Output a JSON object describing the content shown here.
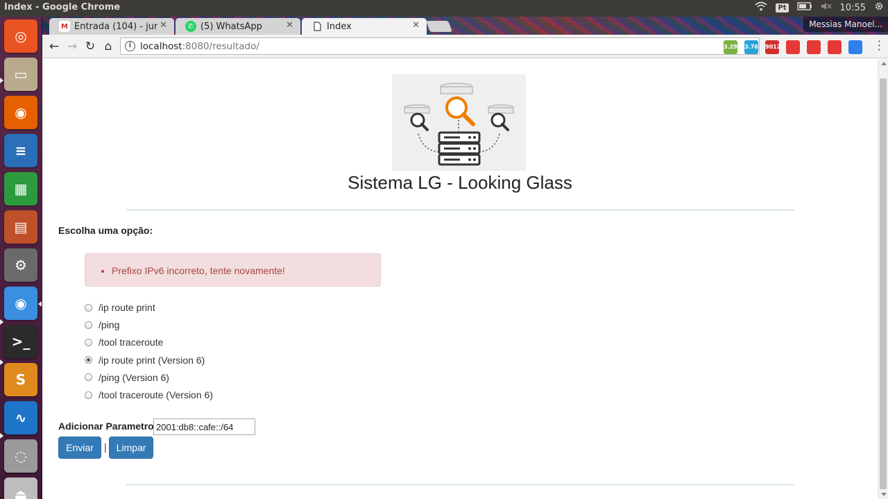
{
  "window": {
    "title": "Index - Google Chrome"
  },
  "tray": {
    "keyboard_layout": "Pt",
    "clock": "10:55"
  },
  "launcher": {
    "apps": [
      {
        "name": "ubuntu-dash",
        "color": "#e95420"
      },
      {
        "name": "files",
        "color": "#b9aa8e"
      },
      {
        "name": "firefox",
        "color": "#e66000"
      },
      {
        "name": "libreoffice-writer",
        "color": "#2a6fb8"
      },
      {
        "name": "libreoffice-calc",
        "color": "#2e9a3e"
      },
      {
        "name": "libreoffice-impress",
        "color": "#c0502a"
      },
      {
        "name": "system-settings",
        "color": "#6a6a6a"
      },
      {
        "name": "chrome",
        "color": "#3a8fe0"
      },
      {
        "name": "terminal",
        "color": "#2b2b2b"
      },
      {
        "name": "sublime-text",
        "color": "#e08a1e"
      },
      {
        "name": "system-monitor",
        "color": "#1e74c9"
      },
      {
        "name": "disk",
        "color": "#9a9a9a"
      },
      {
        "name": "usb-drive",
        "color": "#bdbdbd"
      }
    ]
  },
  "tabs": [
    {
      "label": "Entrada (104) - jun",
      "favicon": "gmail-icon",
      "active": false
    },
    {
      "label": "(5) WhatsApp",
      "favicon": "whatsapp-icon",
      "active": false
    },
    {
      "label": "Index",
      "favicon": "page-icon",
      "active": true
    }
  ],
  "profile": {
    "name": "Messias Manoel..."
  },
  "address_bar": {
    "host": "localhost",
    "rest": ":8080/resultado/"
  },
  "extensions": [
    {
      "name": "extension-android-green",
      "text": "3.29",
      "color": "#7cb342"
    },
    {
      "name": "extension-android-blue",
      "text": "3.76",
      "color": "#29a3d6"
    },
    {
      "name": "extension-gmail-counter",
      "text": "9012",
      "color": "#d32f2f"
    },
    {
      "name": "extension-red-1",
      "text": "",
      "color": "#e53935"
    },
    {
      "name": "extension-red-2",
      "text": "",
      "color": "#e53935"
    },
    {
      "name": "extension-opera",
      "text": "",
      "color": "#e53935"
    },
    {
      "name": "extension-blue",
      "text": "",
      "color": "#2f80ed"
    }
  ],
  "page": {
    "title": "Sistema LG - Looking Glass",
    "choose_label": "Escolha uma opção:",
    "error_message": "Prefixo IPv6 incorreto, tente novamente!",
    "options": [
      {
        "label": "/ip route print",
        "selected": false
      },
      {
        "label": "/ping",
        "selected": false
      },
      {
        "label": "/tool traceroute",
        "selected": false
      },
      {
        "label": "/ip route print (Version 6)",
        "selected": true
      },
      {
        "label": "/ping (Version 6)",
        "selected": false
      },
      {
        "label": "/tool traceroute (Version 6)",
        "selected": false
      }
    ],
    "param_label": "Adicionar Parametro:",
    "param_value": "2001:db8::cafe::/64",
    "submit_label": "Enviar",
    "separator": "|",
    "clear_label": "Limpar"
  }
}
